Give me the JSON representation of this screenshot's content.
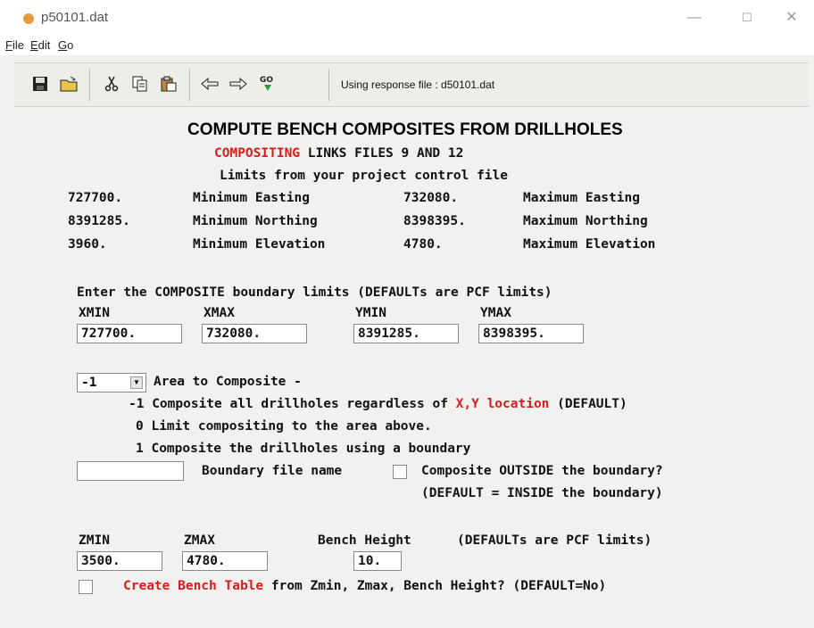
{
  "window": {
    "title": "p50101.dat",
    "minimize": "—",
    "maximize": "☐",
    "close": "✕"
  },
  "menu": {
    "file": "ile",
    "edit": "dit",
    "go": "o"
  },
  "toolbar": {
    "status": "Using response file : d50101.dat"
  },
  "heading": {
    "main": "COMPUTE BENCH COMPOSITES FROM DRILLHOLES",
    "sub_red": "COMPOSITING",
    "sub_rest": " LINKS FILES 9 AND 12",
    "limits": "Limits from your project control file"
  },
  "pcf": {
    "min_e": "727700.",
    "min_e_lbl": "Minimum Easting",
    "max_e": "732080.",
    "max_e_lbl": "Maximum Easting",
    "min_n": "8391285.",
    "min_n_lbl": "Minimum Northing",
    "max_n": "8398395.",
    "max_n_lbl": "Maximum Northing",
    "min_z": "3960.",
    "min_z_lbl": "Minimum Elevation",
    "max_z": "4780.",
    "max_z_lbl": "Maximum Elevation"
  },
  "composite": {
    "prompt": "Enter the COMPOSITE boundary limits (DEFAULTs are PCF limits)",
    "xmin_lbl": "XMIN",
    "xmax_lbl": "XMAX",
    "ymin_lbl": "YMIN",
    "ymax_lbl": "YMAX",
    "xmin": "727700.",
    "xmax": "732080.",
    "ymin": "8391285.",
    "ymax": "8398395."
  },
  "area": {
    "value": "-1",
    "label": "Area to Composite -",
    "opt_m1_a": "-1 Composite all drillholes regardless of ",
    "opt_m1_red": "X,Y location",
    "opt_m1_b": " (DEFAULT)",
    "opt_0": "0 Limit compositing to the area above.",
    "opt_1": "1 Composite the drillholes using a boundary"
  },
  "boundary": {
    "file_value": "",
    "file_label": "Boundary file name",
    "outside_label": "Composite OUTSIDE the boundary?",
    "default_note": "(DEFAULT = INSIDE the boundary)"
  },
  "bench": {
    "zmin_lbl": "ZMIN",
    "zmax_lbl": "ZMAX",
    "height_lbl": "Bench Height",
    "note": "(DEFAULTs are PCF limits)",
    "zmin": "3500.",
    "zmax": "4780.",
    "height": "10.",
    "create_red": "Create Bench Table",
    "create_rest": " from Zmin, Zmax, Bench Height? (DEFAULT=No)"
  }
}
